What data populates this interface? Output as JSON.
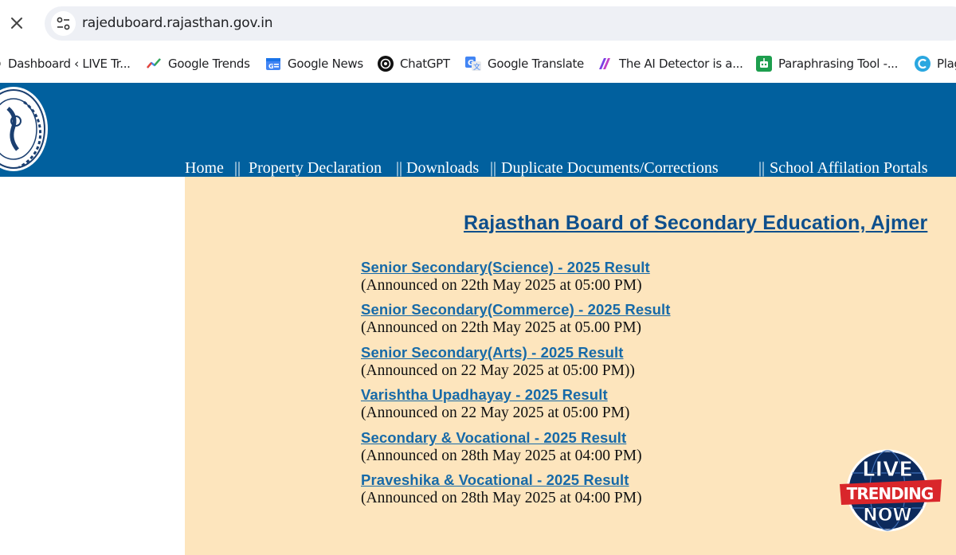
{
  "browser": {
    "url": "rajeduboard.rajasthan.gov.in",
    "bookmarks": [
      {
        "label": "Dashboard ‹ LIVE Tr...",
        "icon": "circle-icon"
      },
      {
        "label": "Google Trends",
        "icon": "google-trends-icon"
      },
      {
        "label": "Google News",
        "icon": "google-news-icon"
      },
      {
        "label": "ChatGPT",
        "icon": "chatgpt-icon"
      },
      {
        "label": "Google Translate",
        "icon": "google-translate-icon"
      },
      {
        "label": "The AI Detector is a...",
        "icon": "ai-detector-icon"
      },
      {
        "label": "Paraphrasing Tool -...",
        "icon": "paraphrasing-tool-icon"
      },
      {
        "label": "Plag",
        "icon": "plag-icon"
      }
    ]
  },
  "site": {
    "nav": [
      "Home",
      "||",
      "Property Declaration",
      "||",
      "Downloads",
      "||",
      "Duplicate Documents/Corrections",
      "||",
      "School Affilation Portals"
    ],
    "title": "Rajasthan Board of Secondary Education, Ajmer",
    "results": [
      {
        "link": "Senior Secondary(Science) - 2025 Result",
        "note": "(Announced on 22th May 2025 at 05:00 PM)"
      },
      {
        "link": "Senior Secondary(Commerce) - 2025 Result",
        "note": "(Announced on 22th May 2025 at 05.00 PM)"
      },
      {
        "link": "Senior Secondary(Arts) - 2025 Result",
        "note": "(Announced on 22 May 2025 at 05:00 PM))"
      },
      {
        "link": "Varishtha Upadhayay - 2025 Result",
        "note": "(Announced on 22 May 2025 at 05:00 PM)"
      },
      {
        "link": "Secondary & Vocational - 2025 Result",
        "note": "(Announced on 28th May 2025 at 04:00 PM)"
      },
      {
        "link": "Praveshika & Vocational - 2025 Result",
        "note": "(Announced on 28th May 2025 at 04:00 PM)"
      }
    ],
    "colors": {
      "header": "#01609e",
      "panel": "#fde5bd",
      "link": "#176aa8",
      "title": "#0e4f8c"
    }
  },
  "watermark": {
    "line1": "LIVE",
    "line2": "TRENDING",
    "line3": "NOW"
  }
}
